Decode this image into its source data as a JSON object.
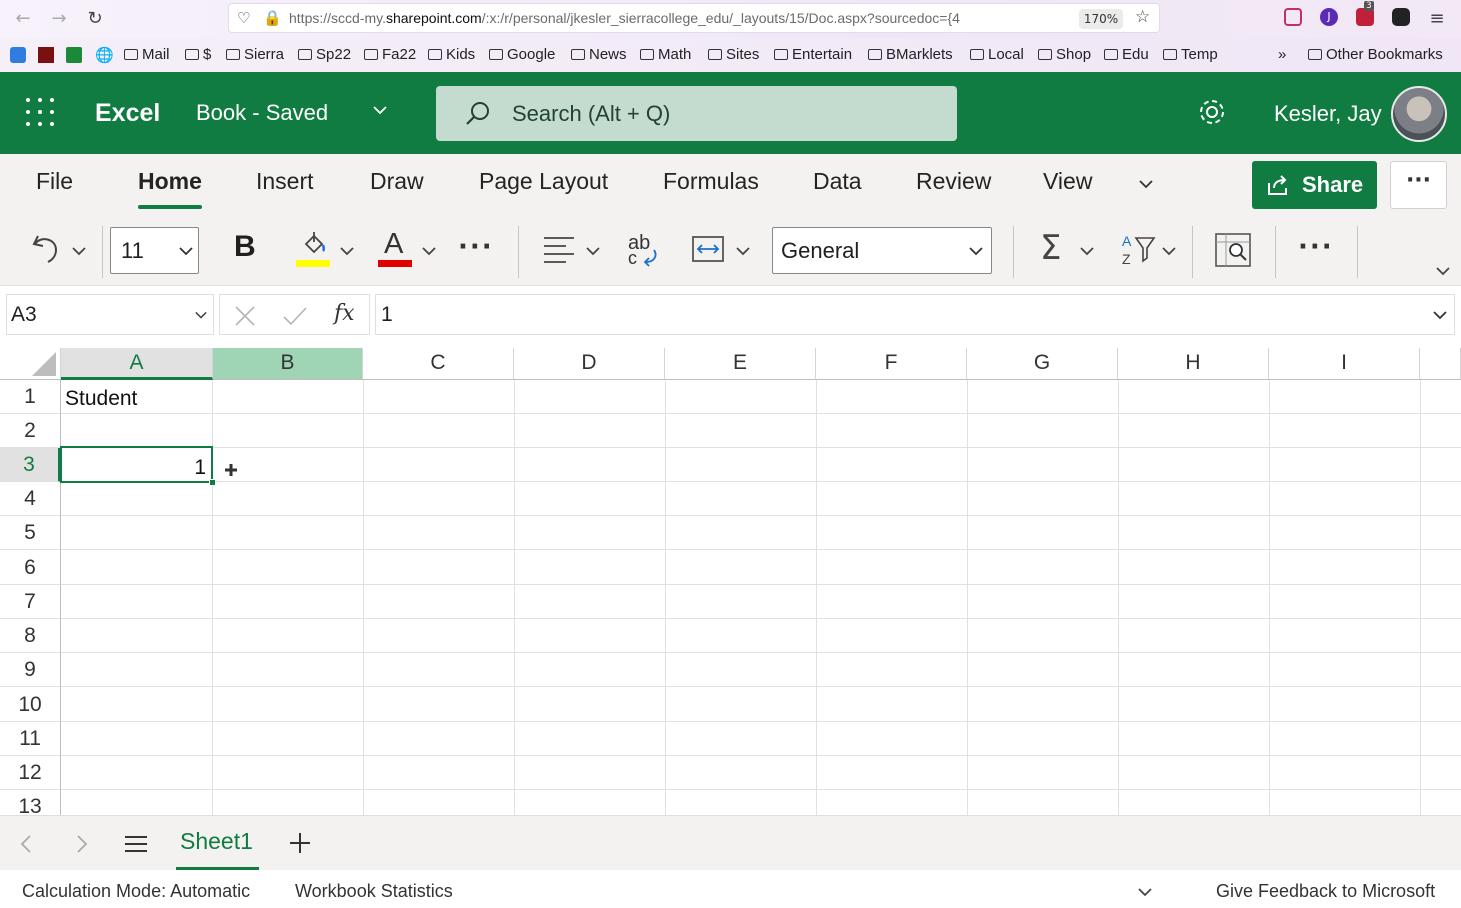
{
  "browser": {
    "url_prefix": "https://sccd-my.",
    "url_domain": "sharepoint.com",
    "url_rest": "/:x:/r/personal/jkesler_sierracollege_edu/_layouts/15/Doc.aspx?sourcedoc={4",
    "zoom": "170%",
    "extension_badge": "3",
    "bookmarks": [
      "Mail",
      "$",
      "Sierra",
      "Sp22",
      "Fa22",
      "Kids",
      "Google",
      "News",
      "Math",
      "Sites",
      "Entertain",
      "BMarklets",
      "Local",
      "Shop",
      "Edu",
      "Temp"
    ],
    "other_bookmarks": "Other Bookmarks"
  },
  "header": {
    "app_name": "Excel",
    "doc_title": "Book  -  Saved",
    "search_placeholder": "Search (Alt + Q)",
    "user_name": "Kesler, Jay"
  },
  "ribbon": {
    "tabs": [
      "File",
      "Home",
      "Insert",
      "Draw",
      "Page Layout",
      "Formulas",
      "Data",
      "Review",
      "View"
    ],
    "active_tab": "Home",
    "share_label": "Share",
    "more_label": "···"
  },
  "toolbar": {
    "font_size": "11",
    "bold_label": "B",
    "font_color_label": "A",
    "wrap_label": "ab",
    "number_format": "General",
    "fill_color": "#ffff00",
    "font_color": "#e00000"
  },
  "formula_bar": {
    "name_box": "A3",
    "fx_label": "fx",
    "value": "1"
  },
  "grid": {
    "columns": [
      "A",
      "B",
      "C",
      "D",
      "E",
      "F",
      "G",
      "H",
      "I"
    ],
    "rows": [
      "1",
      "2",
      "3",
      "4",
      "5",
      "6",
      "7",
      "8",
      "9",
      "10",
      "11",
      "12",
      "13"
    ],
    "cells": {
      "A1": "Student",
      "A3": "1"
    },
    "active_cell": "A3"
  },
  "sheets": {
    "tabs": [
      "Sheet1"
    ],
    "active": "Sheet1"
  },
  "status_bar": {
    "calc_mode": "Calculation Mode: Automatic",
    "workbook_stats": "Workbook Statistics",
    "feedback": "Give Feedback to Microsoft"
  },
  "colors": {
    "brand": "#107c41",
    "hover_column": "#9fd5b5"
  }
}
